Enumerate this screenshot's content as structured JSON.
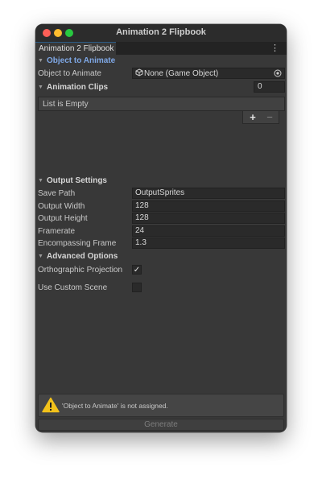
{
  "window": {
    "title": "Animation 2 Flipbook",
    "tab_label": "Animation 2 Flipbook",
    "menu_glyph": "⋮"
  },
  "sections": {
    "object_to_animate": {
      "header": "Object to Animate",
      "field_label": "Object to Animate",
      "field_value": "None (Game Object)"
    },
    "animation_clips": {
      "header": "Animation Clips",
      "count": "0",
      "empty_text": "List is Empty",
      "add_glyph": "+",
      "remove_glyph": "−"
    },
    "output_settings": {
      "header": "Output Settings",
      "fields": [
        {
          "label": "Save Path",
          "value": "OutputSprites"
        },
        {
          "label": "Output Width",
          "value": "128"
        },
        {
          "label": "Output Height",
          "value": "128"
        },
        {
          "label": "Framerate",
          "value": "24"
        },
        {
          "label": "Encompassing Frame",
          "value": "1.3"
        }
      ]
    },
    "advanced_options": {
      "header": "Advanced Options",
      "orthographic_label": "Orthographic Projection",
      "orthographic_checked": true,
      "check_glyph": "✓",
      "custom_scene_label": "Use Custom Scene",
      "custom_scene_checked": false
    }
  },
  "help": {
    "message": "'Object to Animate' is not assigned."
  },
  "generate_button": "Generate",
  "colors": {
    "window_bg": "#383838",
    "section_accent": "#7fa8e6",
    "warning_yellow": "#f2c21b"
  }
}
